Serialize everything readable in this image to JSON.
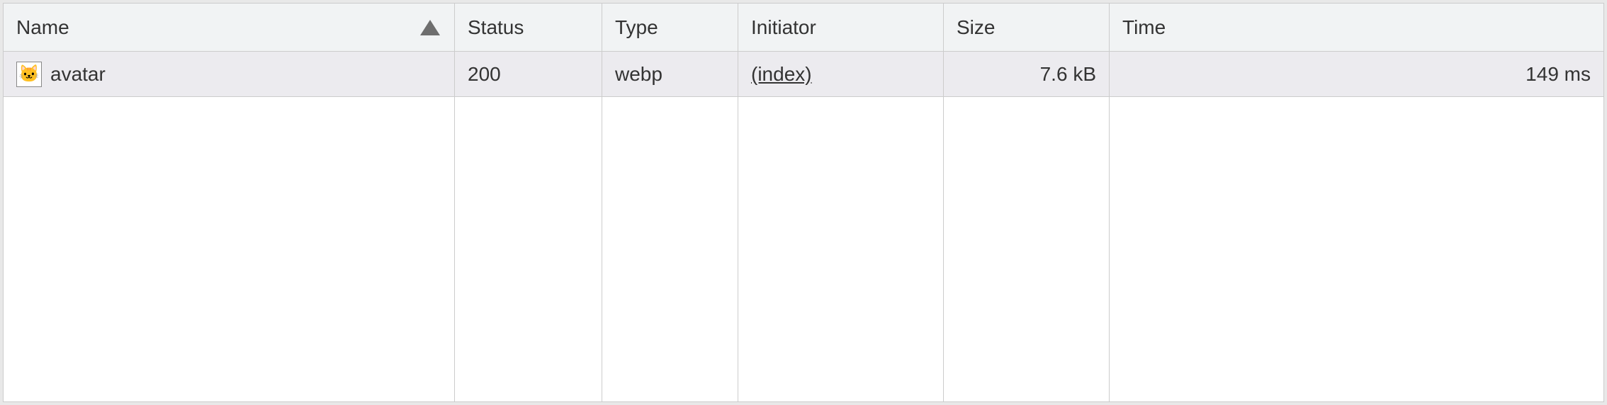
{
  "columns": {
    "name": "Name",
    "status": "Status",
    "type": "Type",
    "initiator": "Initiator",
    "size": "Size",
    "time": "Time"
  },
  "sort": {
    "column": "name",
    "direction": "asc"
  },
  "rows": [
    {
      "name": "avatar",
      "thumb_icon": "🐱",
      "status": "200",
      "type": "webp",
      "initiator": "(index)",
      "size": "7.6 kB",
      "time": "149 ms"
    }
  ]
}
